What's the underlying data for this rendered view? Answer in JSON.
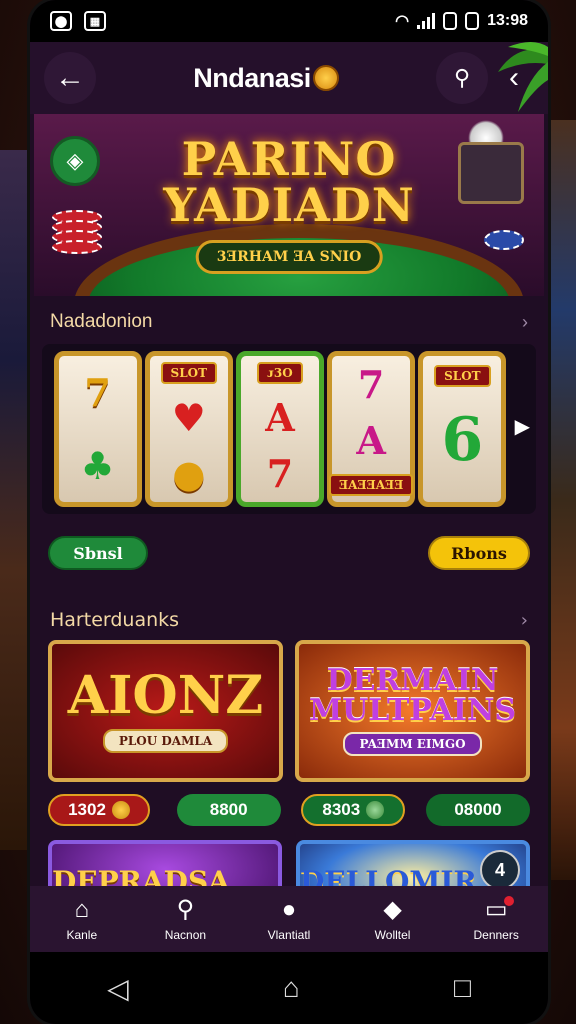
{
  "status": {
    "left_icons": [
      "media-icon",
      "notification-icon"
    ],
    "time": "13:98"
  },
  "appbar": {
    "title": "Nndanasi"
  },
  "banner": {
    "title_line1": "PARINO",
    "title_line2": "YADIADN",
    "subtitle": "3ƎRHAM ƎA SNIO"
  },
  "section1": {
    "title": "Nadadonion",
    "reels": [
      {
        "tag": "",
        "top": "7",
        "bottom": "♣"
      },
      {
        "tag": "SLOT",
        "top": "♥",
        "bottom": "●"
      },
      {
        "tag": "ᴊ3O",
        "top": "A",
        "bottom": "7"
      },
      {
        "tag": "",
        "top": "7",
        "bottom": "A"
      },
      {
        "tag": "SLOT",
        "top": "6",
        "bottom": ""
      }
    ],
    "reel4_tag": "ƎAƎƎAƎƎ",
    "btn_left": "Sbnsl",
    "btn_right": "Rbons"
  },
  "section2": {
    "title": "Harterduanks",
    "cards": [
      {
        "title": "AIONZ",
        "subtitle": "PLOU DAMLA"
      },
      {
        "title": "DERMAIN MULTPAINS",
        "subtitle": "PAƎMM EIMGO"
      }
    ],
    "badges": [
      "1302",
      "8800",
      "8303",
      "08000"
    ],
    "cards2": [
      {
        "title": "DEPRADSA MULPANING"
      },
      {
        "title": "DELLOMIR MULTINGS"
      }
    ],
    "card2_number": "4"
  },
  "bottomnav": {
    "items": [
      {
        "label": "Kanle",
        "icon": "home-icon"
      },
      {
        "label": "Nacnon",
        "icon": "search-icon"
      },
      {
        "label": "Vlantiatl",
        "icon": "chat-icon"
      },
      {
        "label": "Wolltel",
        "icon": "users-icon"
      },
      {
        "label": "Denners",
        "icon": "wallet-icon"
      }
    ]
  }
}
